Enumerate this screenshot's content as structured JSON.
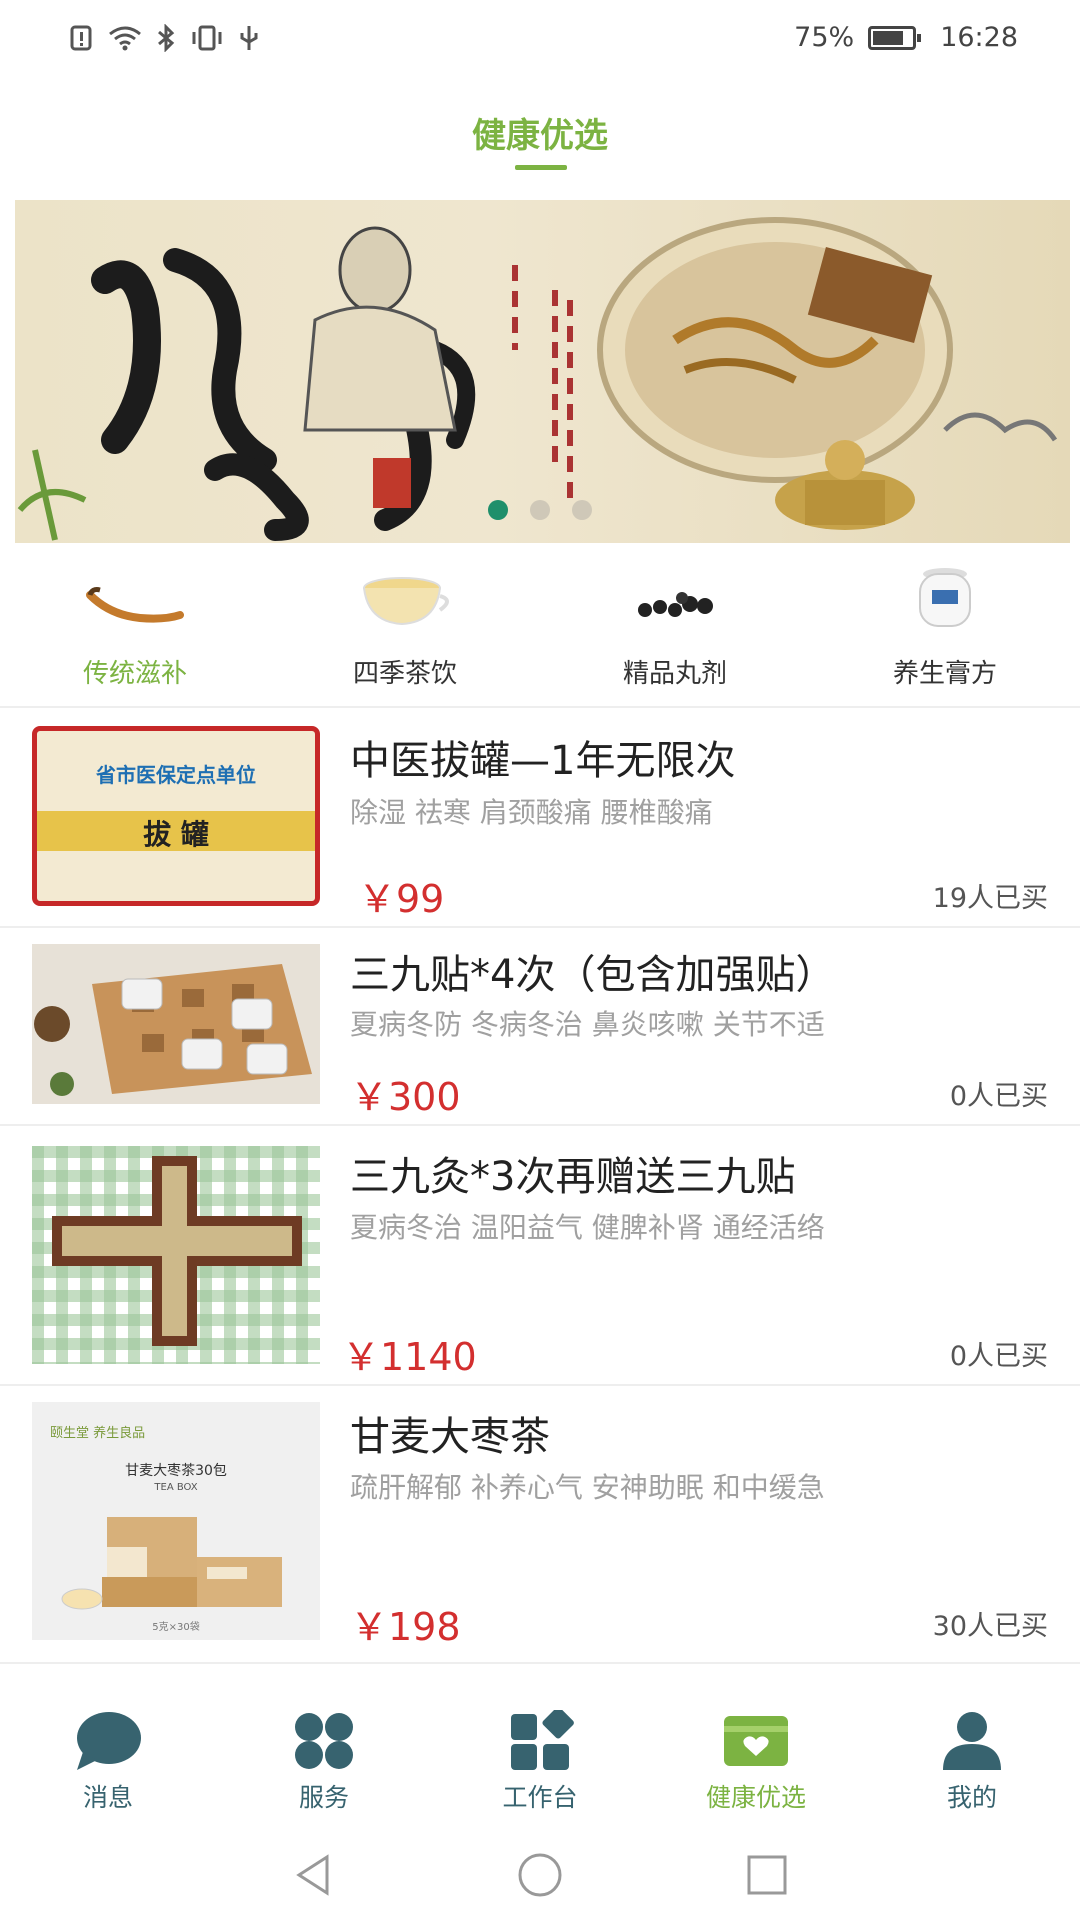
{
  "status_bar": {
    "battery_percent": "75%",
    "time": "16:28",
    "left_icons": [
      "alert-icon",
      "wifi-icon",
      "bluetooth-icon",
      "vibrate-icon",
      "usb-icon"
    ]
  },
  "header": {
    "title": "健康优选"
  },
  "banner": {
    "slide_count": 3,
    "active_slide": 1
  },
  "categories": [
    {
      "label": "传统滋补",
      "icon": "cordyceps-icon",
      "selected": true
    },
    {
      "label": "四季茶饮",
      "icon": "tea-cup-icon",
      "selected": false
    },
    {
      "label": "精品丸剂",
      "icon": "pills-icon",
      "selected": false
    },
    {
      "label": "养生膏方",
      "icon": "jar-icon",
      "selected": false
    }
  ],
  "products": [
    {
      "title": "中医拔罐—1年无限次",
      "tags": "除湿 祛寒 肩颈酸痛 腰椎酸痛",
      "price": "￥99",
      "sold": "19人已买",
      "image_text": {
        "line1": "省市医保定点单位",
        "line2": "拔 罐"
      }
    },
    {
      "title": "三九贴*4次（包含加强贴）",
      "tags": "夏病冬防 冬病冬治 鼻炎咳嗽 关节不适",
      "price": "￥300",
      "sold": "0人已买"
    },
    {
      "title": "三九灸*3次再赠送三九贴",
      "tags": "夏病冬治 温阳益气 健脾补肾 通经活络",
      "price": "￥1140",
      "sold": "0人已买"
    },
    {
      "title": "甘麦大枣茶",
      "tags": "疏肝解郁 补养心气 安神助眠 和中缓急",
      "price": "￥198",
      "sold": "30人已买",
      "image_text": {
        "brand": "颐生堂 养生良品",
        "name": "甘麦大枣茶30包",
        "sub": "TEA BOX",
        "spec": "5克×30袋"
      }
    }
  ],
  "bottom_nav": [
    {
      "label": "消息",
      "icon": "message-icon"
    },
    {
      "label": "服务",
      "icon": "service-grid-icon"
    },
    {
      "label": "工作台",
      "icon": "workbench-icon"
    },
    {
      "label": "健康优选",
      "icon": "health-card-icon",
      "active": true
    },
    {
      "label": "我的",
      "icon": "profile-icon"
    }
  ],
  "colors": {
    "accent_green": "#7cb342",
    "price_red": "#d32f2f",
    "nav_teal": "#37636f"
  }
}
